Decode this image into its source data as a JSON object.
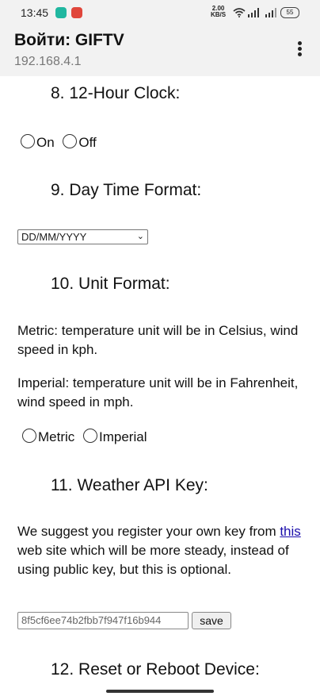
{
  "status_bar": {
    "time": "13:45",
    "net_speed_value": "2.00",
    "net_speed_unit": "KB/S",
    "battery": "55",
    "icons": [
      "message-icon",
      "app-notification-icon",
      "wifi-icon",
      "signal-icon",
      "signal-icon",
      "battery-icon"
    ]
  },
  "app_bar": {
    "title": "Войти: GIFTV",
    "url": "192.168.4.1",
    "menu_icon": "more-vert-icon"
  },
  "sections": {
    "clock": {
      "heading": "8. 12-Hour Clock:",
      "options": [
        "On",
        "Off"
      ]
    },
    "day_format": {
      "heading": "9. Day Time Format:",
      "selected": "DD/MM/YYYY"
    },
    "unit_format": {
      "heading": "10. Unit Format:",
      "metric_desc": "Metric: temperature unit will be in Celsius, wind speed in kph.",
      "imperial_desc": "Imperial: temperature unit will be in Fahrenheit, wind speed in mph.",
      "options": [
        "Metric",
        "Imperial"
      ]
    },
    "weather_api": {
      "heading": "11. Weather API Key:",
      "desc_before": "We suggest you register your own key from ",
      "link_text": "this",
      "desc_after": " web site which will be more steady, instead of using public key, but this is optional.",
      "key_value": "8f5cf6ee74b2fbb7f947f16b944",
      "save_label": "save"
    },
    "reset": {
      "heading": "12. Reset or Reboot Device:"
    }
  },
  "colors": {
    "link": "#1a0dab",
    "bar_bg": "#f2f2f2"
  }
}
